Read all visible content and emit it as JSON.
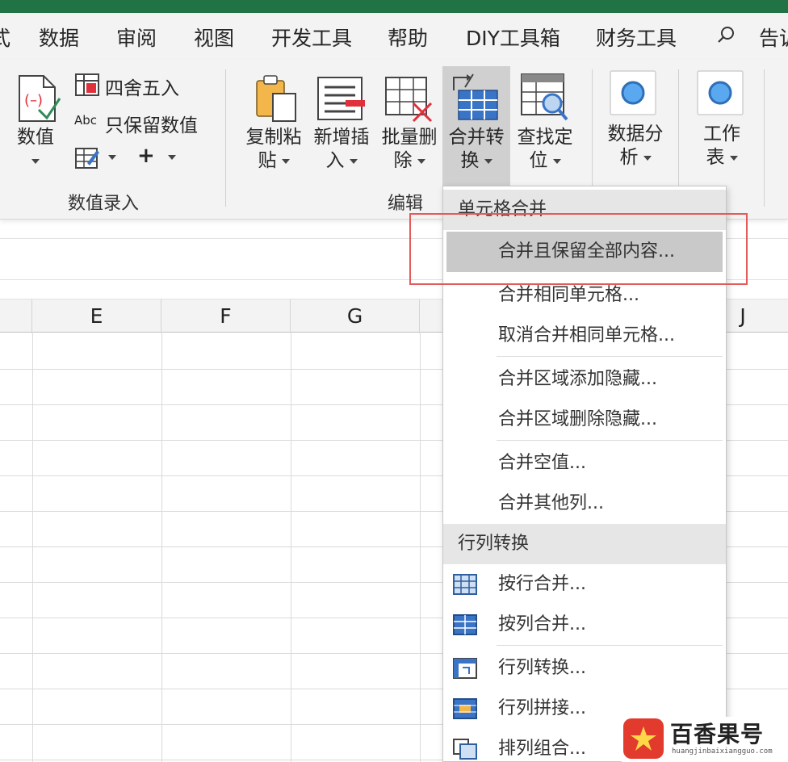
{
  "tabs": [
    "式",
    "数据",
    "审阅",
    "视图",
    "开发工具",
    "帮助",
    "DIY工具箱",
    "财务工具",
    "告诉"
  ],
  "ribbon": {
    "value_button": "数值",
    "round_item": "四舍五入",
    "keep_value_item": "只保留数值",
    "plus_symbol": "+",
    "group_value_entry": "数值录入",
    "copy_paste": [
      "复制粘",
      "贴"
    ],
    "insert": [
      "新增插",
      "入"
    ],
    "delete": [
      "批量删",
      "除"
    ],
    "merge": [
      "合并转",
      "换"
    ],
    "find": [
      "查找定",
      "位"
    ],
    "group_edit": "编辑",
    "analysis": [
      "数据分",
      "析"
    ],
    "worksheet": [
      "工作",
      "表"
    ]
  },
  "columns": [
    "E",
    "F",
    "G",
    "J"
  ],
  "menu": {
    "header_merge": "单元格合并",
    "items_merge": [
      "合并且保留全部内容...",
      "合并相同单元格...",
      "取消合并相同单元格...",
      "合并区域添加隐藏...",
      "合并区域删除隐藏...",
      "合并空值...",
      "合并其他列..."
    ],
    "header_convert": "行列转换",
    "items_convert": [
      "按行合并...",
      "按列合并...",
      "行列转换...",
      "行列拼接...",
      "排列组合..."
    ]
  },
  "watermark": {
    "name": "百香果号",
    "domain": "huangjinbaixiangguo.com"
  },
  "colors": {
    "title_bar": "#217346",
    "highlight": "#c9c9c9",
    "annotation": "#e35a5a"
  }
}
